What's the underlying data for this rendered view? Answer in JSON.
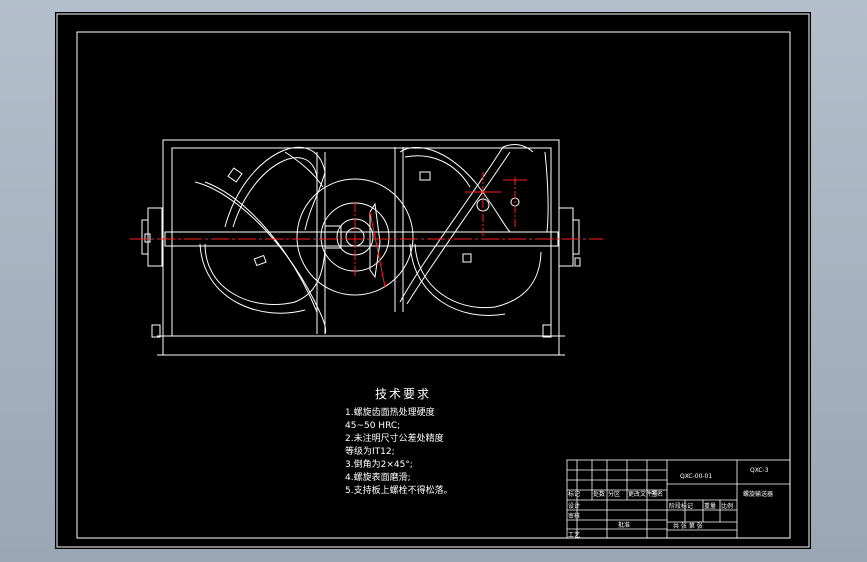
{
  "tech_requirements": {
    "title": "技术要求",
    "lines": [
      "1.螺旋齿面热处理硬度",
      "45~50 HRC;",
      "2.未注明尺寸公差处精度",
      "等级为IT12;",
      "3.倒角为2×45°;",
      "4.螺旋表面磨滑;",
      "5.支持板上螺栓不得松落。"
    ]
  },
  "title_block": {
    "drawing_no": "QXC-00-01",
    "mark": "QXC-3",
    "name": "螺旋输送器",
    "row_labels": [
      "标记",
      "处数",
      "分区",
      "更改文件号",
      "签名"
    ],
    "left_labels": [
      "设计",
      "审核",
      "工艺"
    ],
    "stage_label": "阶段标记",
    "weight_label": "重量",
    "scale_label": "比例",
    "sheet_label": "共 张 第 张",
    "approve_label": "批准"
  },
  "colors": {
    "lines": "#ffffff",
    "centerline": "#ff2020",
    "sheet": "#000000"
  }
}
